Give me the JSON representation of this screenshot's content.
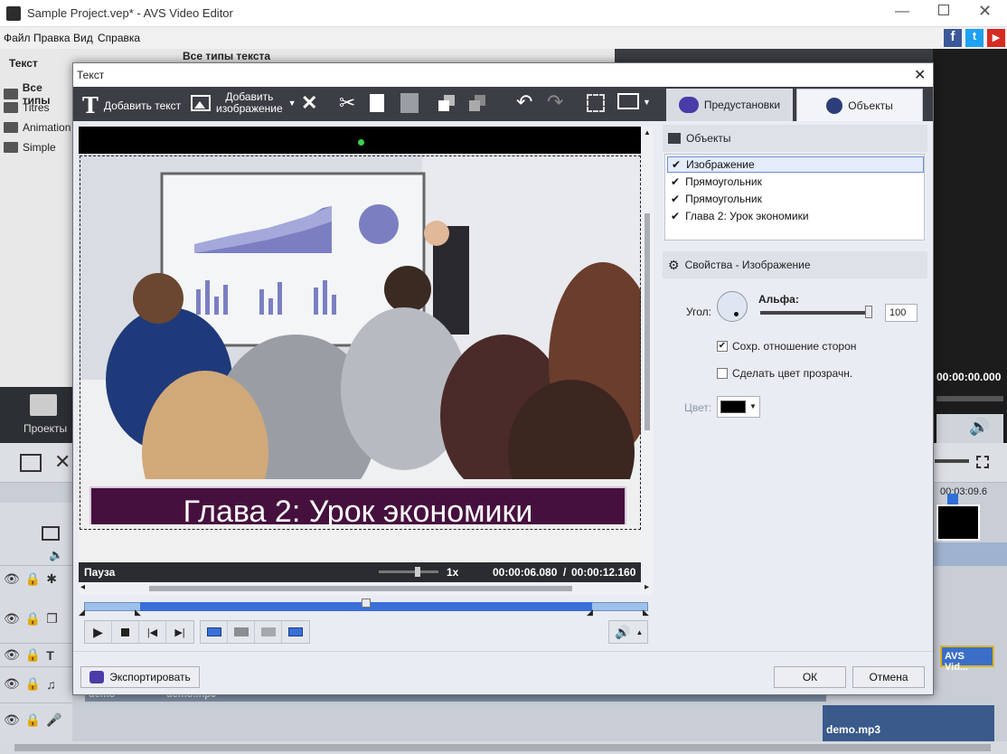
{
  "app": {
    "window_title": "Sample Project.vep* - AVS Video Editor"
  },
  "menu": [
    "Файл",
    "Правка",
    "Вид",
    "Справка"
  ],
  "left_panel": {
    "header": "Текст",
    "items": [
      "Все типы",
      "Titres",
      "Animation",
      "Simple"
    ],
    "projects_label": "Проекты"
  },
  "behind": {
    "right_time": "00:00:00.000",
    "timeline_time": "00:03:09.6",
    "clip_label": "AVS Vid...",
    "audio_label": "demo.mp3",
    "audio_label2": "demo.mp3",
    "video_track_label": "demo",
    "header_partial": "Все типы текста"
  },
  "dialog": {
    "title": "Текст",
    "toolbar": {
      "add_text": "Добавить текст",
      "add_image": "Добавить\nизображение",
      "add_image_line1": "Добавить",
      "add_image_line2": "изображение"
    },
    "tabs": {
      "presets": "Предустановки",
      "objects": "Объекты"
    },
    "preview": {
      "caption": "Глава 2: Урок экономики",
      "status": "Пауза",
      "speed": "1x",
      "current_time": "00:00:06.080",
      "separator": "/",
      "total_time": "00:00:12.160"
    },
    "objects_panel": {
      "header": "Объекты",
      "items": [
        "Изображение",
        "Прямоугольник",
        "Прямоугольник",
        "Глава 2: Урок экономики"
      ],
      "selected_index": 0
    },
    "properties": {
      "header": "Свойства - Изображение",
      "angle_label": "Угол:",
      "alpha_label": "Альфа:",
      "alpha_value": "100",
      "alpha_fraction": 1.0,
      "keep_aspect_label": "Сохр. отношение сторон",
      "keep_aspect_checked": true,
      "transparent_label": "Сделать цвет прозрачн.",
      "transparent_checked": false,
      "color_label": "Цвет:",
      "color_value": "#000000"
    },
    "buttons": {
      "export": "Экспортировать",
      "ok": "ОК",
      "cancel": "Отмена"
    },
    "playhead_fraction": 0.5
  },
  "colors": {
    "accent_blue": "#3a6fd8",
    "caption_bg": "#46103e",
    "toolbar_bg": "#3b3e44"
  }
}
